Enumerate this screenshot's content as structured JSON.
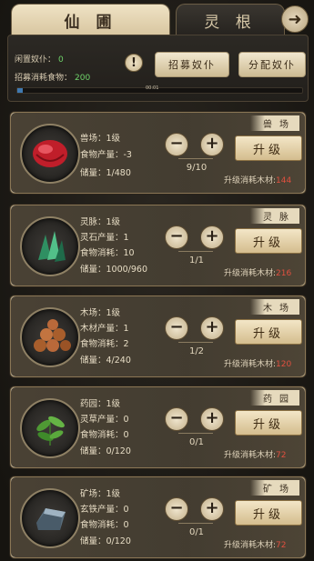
{
  "tabs": {
    "active": "仙 圃",
    "inactive": "灵 根"
  },
  "corner_icon": "arrow-right-icon",
  "top": {
    "idle_label": "闲置奴仆：",
    "idle_value": "0",
    "food_label": "招募消耗食物：",
    "food_value": "200",
    "alert_glyph": "!",
    "recruit_label": "招募奴仆",
    "assign_label": "分配奴仆",
    "progress_text": "00:01",
    "progress_fraction": 0.01
  },
  "cards": [
    {
      "seal": "兽场",
      "icon": "red-gem-icon",
      "l1": "兽场：1级",
      "l2": "食物产量：-3",
      "l3": "储量：1/480",
      "count": "9/10",
      "upgrade": "升级",
      "cost_label": "升级消耗木材:",
      "cost_value": "144"
    },
    {
      "seal": "灵脉",
      "icon": "green-crystal-icon",
      "l1": "灵脉：1级",
      "l2": "灵石产量：1",
      "l3": "食物消耗：10",
      "l4": "储量：1000/960",
      "count": "1/1",
      "upgrade": "升级",
      "cost_label": "升级消耗木材:",
      "cost_value": "216"
    },
    {
      "seal": "木场",
      "icon": "log-pile-icon",
      "l1": "木场：1级",
      "l2": "木材产量：1",
      "l3": "食物消耗：2",
      "l4": "储量：4/240",
      "count": "1/2",
      "upgrade": "升级",
      "cost_label": "升级消耗木材:",
      "cost_value": "120"
    },
    {
      "seal": "药园",
      "icon": "herb-icon",
      "l1": "药园：1级",
      "l2": "灵草产量：0",
      "l3": "食物消耗：0",
      "l4": "储量：0/120",
      "count": "0/1",
      "upgrade": "升级",
      "cost_label": "升级消耗木材:",
      "cost_value": "72"
    },
    {
      "seal": "矿场",
      "icon": "iron-ingot-icon",
      "l1": "矿场：1级",
      "l2": "玄铁产量：0",
      "l3": "食物消耗：0",
      "l4": "储量：0/120",
      "count": "0/1",
      "upgrade": "升级",
      "cost_label": "升级消耗木材:",
      "cost_value": "72"
    }
  ]
}
